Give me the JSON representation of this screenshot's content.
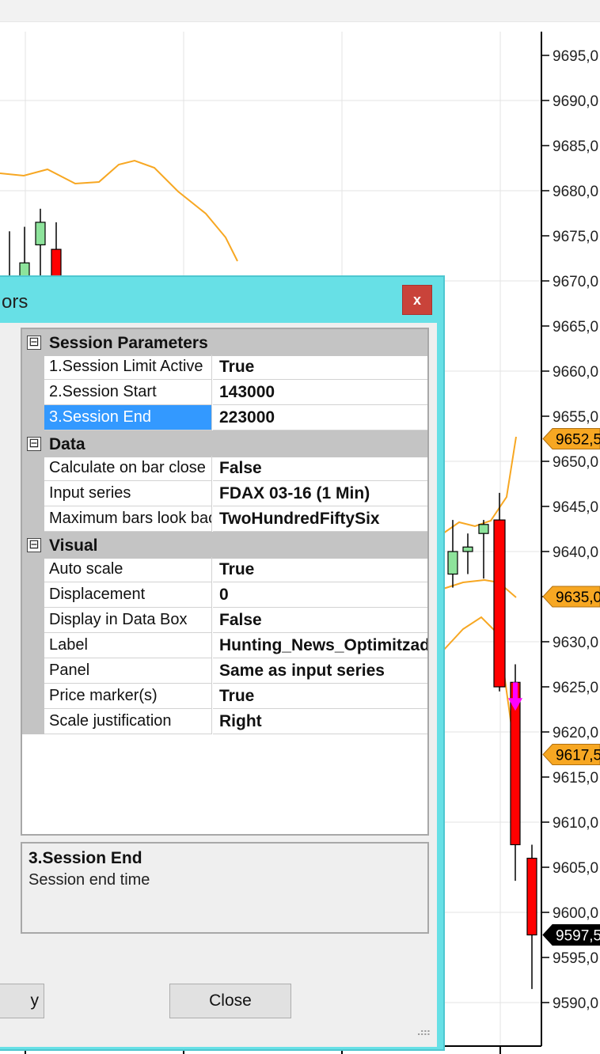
{
  "colors": {
    "accent_dialog": "#67e0e6",
    "close_button": "#c9433a",
    "bull_candle": "#8de39b",
    "bear_candle": "#ff0000",
    "envelope_line": "#f7a722",
    "price_tag_orange": "#f7a722",
    "price_tag_dark": "#000000",
    "signal_arrow": "#ff00ff",
    "selection": "#3399ff"
  },
  "chart": {
    "y_axis_ticks": [
      "9695,0",
      "9690,0",
      "9685,0",
      "9680,0",
      "9675,0",
      "9670,0",
      "9665,0",
      "9660,0",
      "9655,0",
      "9650,0",
      "9645,0",
      "9640,0",
      "9635,0",
      "9630,0",
      "9625,0",
      "9620,0",
      "9615,0",
      "9610,0",
      "9605,0",
      "9600,0",
      "9595,0",
      "9590,0"
    ],
    "price_tags": [
      {
        "text": "9652,5",
        "value": 9652.5,
        "style": "orange"
      },
      {
        "text": "9635,0",
        "value": 9635.0,
        "style": "orange"
      },
      {
        "text": "9617,5",
        "value": 9617.5,
        "style": "orange"
      },
      {
        "text": "9597,5",
        "value": 9597.5,
        "style": "dark"
      }
    ],
    "candles": [
      {
        "open": 9670,
        "high": 9675.5,
        "low": 9668,
        "close": 9670,
        "dir": "flat"
      },
      {
        "open": 9670,
        "high": 9676,
        "low": 9668,
        "close": 9672,
        "dir": "up"
      },
      {
        "open": 9674,
        "high": 9678,
        "low": 9670,
        "close": 9676.5,
        "dir": "up"
      },
      {
        "open": 9673.5,
        "high": 9676.5,
        "low": 9668,
        "close": 9669,
        "dir": "down"
      },
      {
        "open": 9637.5,
        "high": 9643.5,
        "low": 9636,
        "close": 9640,
        "dir": "up"
      },
      {
        "open": 9640,
        "high": 9642,
        "low": 9637.5,
        "close": 9640.5,
        "dir": "up"
      },
      {
        "open": 9642,
        "high": 9643.5,
        "low": 9637,
        "close": 9643,
        "dir": "up"
      },
      {
        "open": 9643.5,
        "high": 9646.5,
        "low": 9624.5,
        "close": 9625,
        "dir": "down"
      },
      {
        "open": 9625.5,
        "high": 9627.5,
        "low": 9603.5,
        "close": 9607.5,
        "dir": "down"
      },
      {
        "open": 9606,
        "high": 9607.5,
        "low": 9591.5,
        "close": 9597.5,
        "dir": "down"
      }
    ]
  },
  "dialog": {
    "title": "ors",
    "close_glyph": "x",
    "categories": [
      {
        "label": "Session Parameters",
        "toggle": "⊟",
        "props": [
          {
            "name": "1.Session Limit Active",
            "value": "True"
          },
          {
            "name": "2.Session Start",
            "value": "143000"
          },
          {
            "name": "3.Session End",
            "value": "223000",
            "selected": true
          }
        ]
      },
      {
        "label": "Data",
        "toggle": "⊟",
        "props": [
          {
            "name": "Calculate on bar close",
            "value": "False"
          },
          {
            "name": "Input series",
            "value": "FDAX 03-16 (1 Min)"
          },
          {
            "name": "Maximum bars look back",
            "value": "TwoHundredFiftySix"
          }
        ]
      },
      {
        "label": "Visual",
        "toggle": "⊟",
        "props": [
          {
            "name": "Auto scale",
            "value": "True"
          },
          {
            "name": "Displacement",
            "value": "0"
          },
          {
            "name": "Display in Data Box",
            "value": "False"
          },
          {
            "name": "Label",
            "value": "Hunting_News_Optimitzado"
          },
          {
            "name": "Panel",
            "value": "Same as input series"
          },
          {
            "name": "Price marker(s)",
            "value": "True"
          },
          {
            "name": "Scale justification",
            "value": "Right"
          }
        ]
      }
    ],
    "help": {
      "title": "3.Session End",
      "description": "Session end time"
    },
    "buttons": {
      "left_partial": "y",
      "close": "Close"
    },
    "resize_grip": "⠴⠶"
  }
}
